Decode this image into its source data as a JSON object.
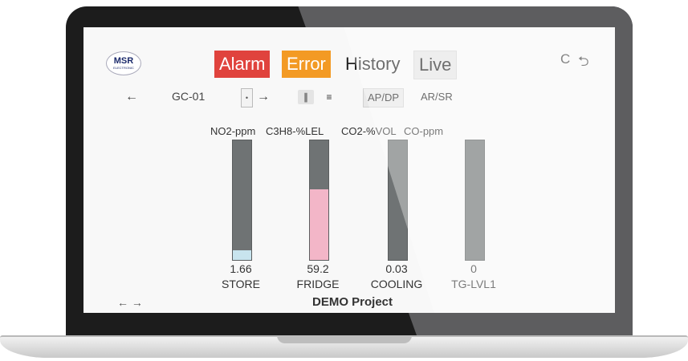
{
  "logo": {
    "title": "MSR",
    "subtitle": "ELECTRONIC"
  },
  "tabs": [
    {
      "label": "Alarm"
    },
    {
      "label": "Error"
    },
    {
      "label": "History"
    },
    {
      "label": "Live"
    }
  ],
  "top_icons": {
    "refresh": "C",
    "logout": "⮌"
  },
  "nav": {
    "back_icon": "←",
    "device": "GC-01",
    "dropdown_glyph": "•",
    "forward_icon": "→",
    "view_bars_icon": "∥",
    "view_list_icon": "≡",
    "chip_ap_dp": "AP/DP",
    "chip_ar_sr": "AR/SR"
  },
  "sensors": [
    {
      "unit": "NO2-ppm",
      "value": "1.66",
      "location": "STORE",
      "fill_fraction": 0.08,
      "fill_color": "#c8e4ee"
    },
    {
      "unit": "C3H8-%LEL",
      "value": "59.2",
      "location": "FRIDGE",
      "fill_fraction": 0.59,
      "fill_color": "#f3b6c8"
    },
    {
      "unit": "CO2-%VOL",
      "value": "0.03",
      "location": "COOLING",
      "fill_fraction": 0,
      "fill_color": "#c8e4ee"
    },
    {
      "unit": "CO-ppm",
      "value": "0",
      "location": "TG-LVL1",
      "fill_fraction": 0,
      "fill_color": "#c8e4ee"
    }
  ],
  "footer": {
    "project": "DEMO Project",
    "partial": "← →"
  },
  "colors": {
    "alarm": "#e0433d",
    "error": "#f39a24",
    "bar_track": "#6f7374",
    "laptop_frame": "#1c1c1c"
  }
}
